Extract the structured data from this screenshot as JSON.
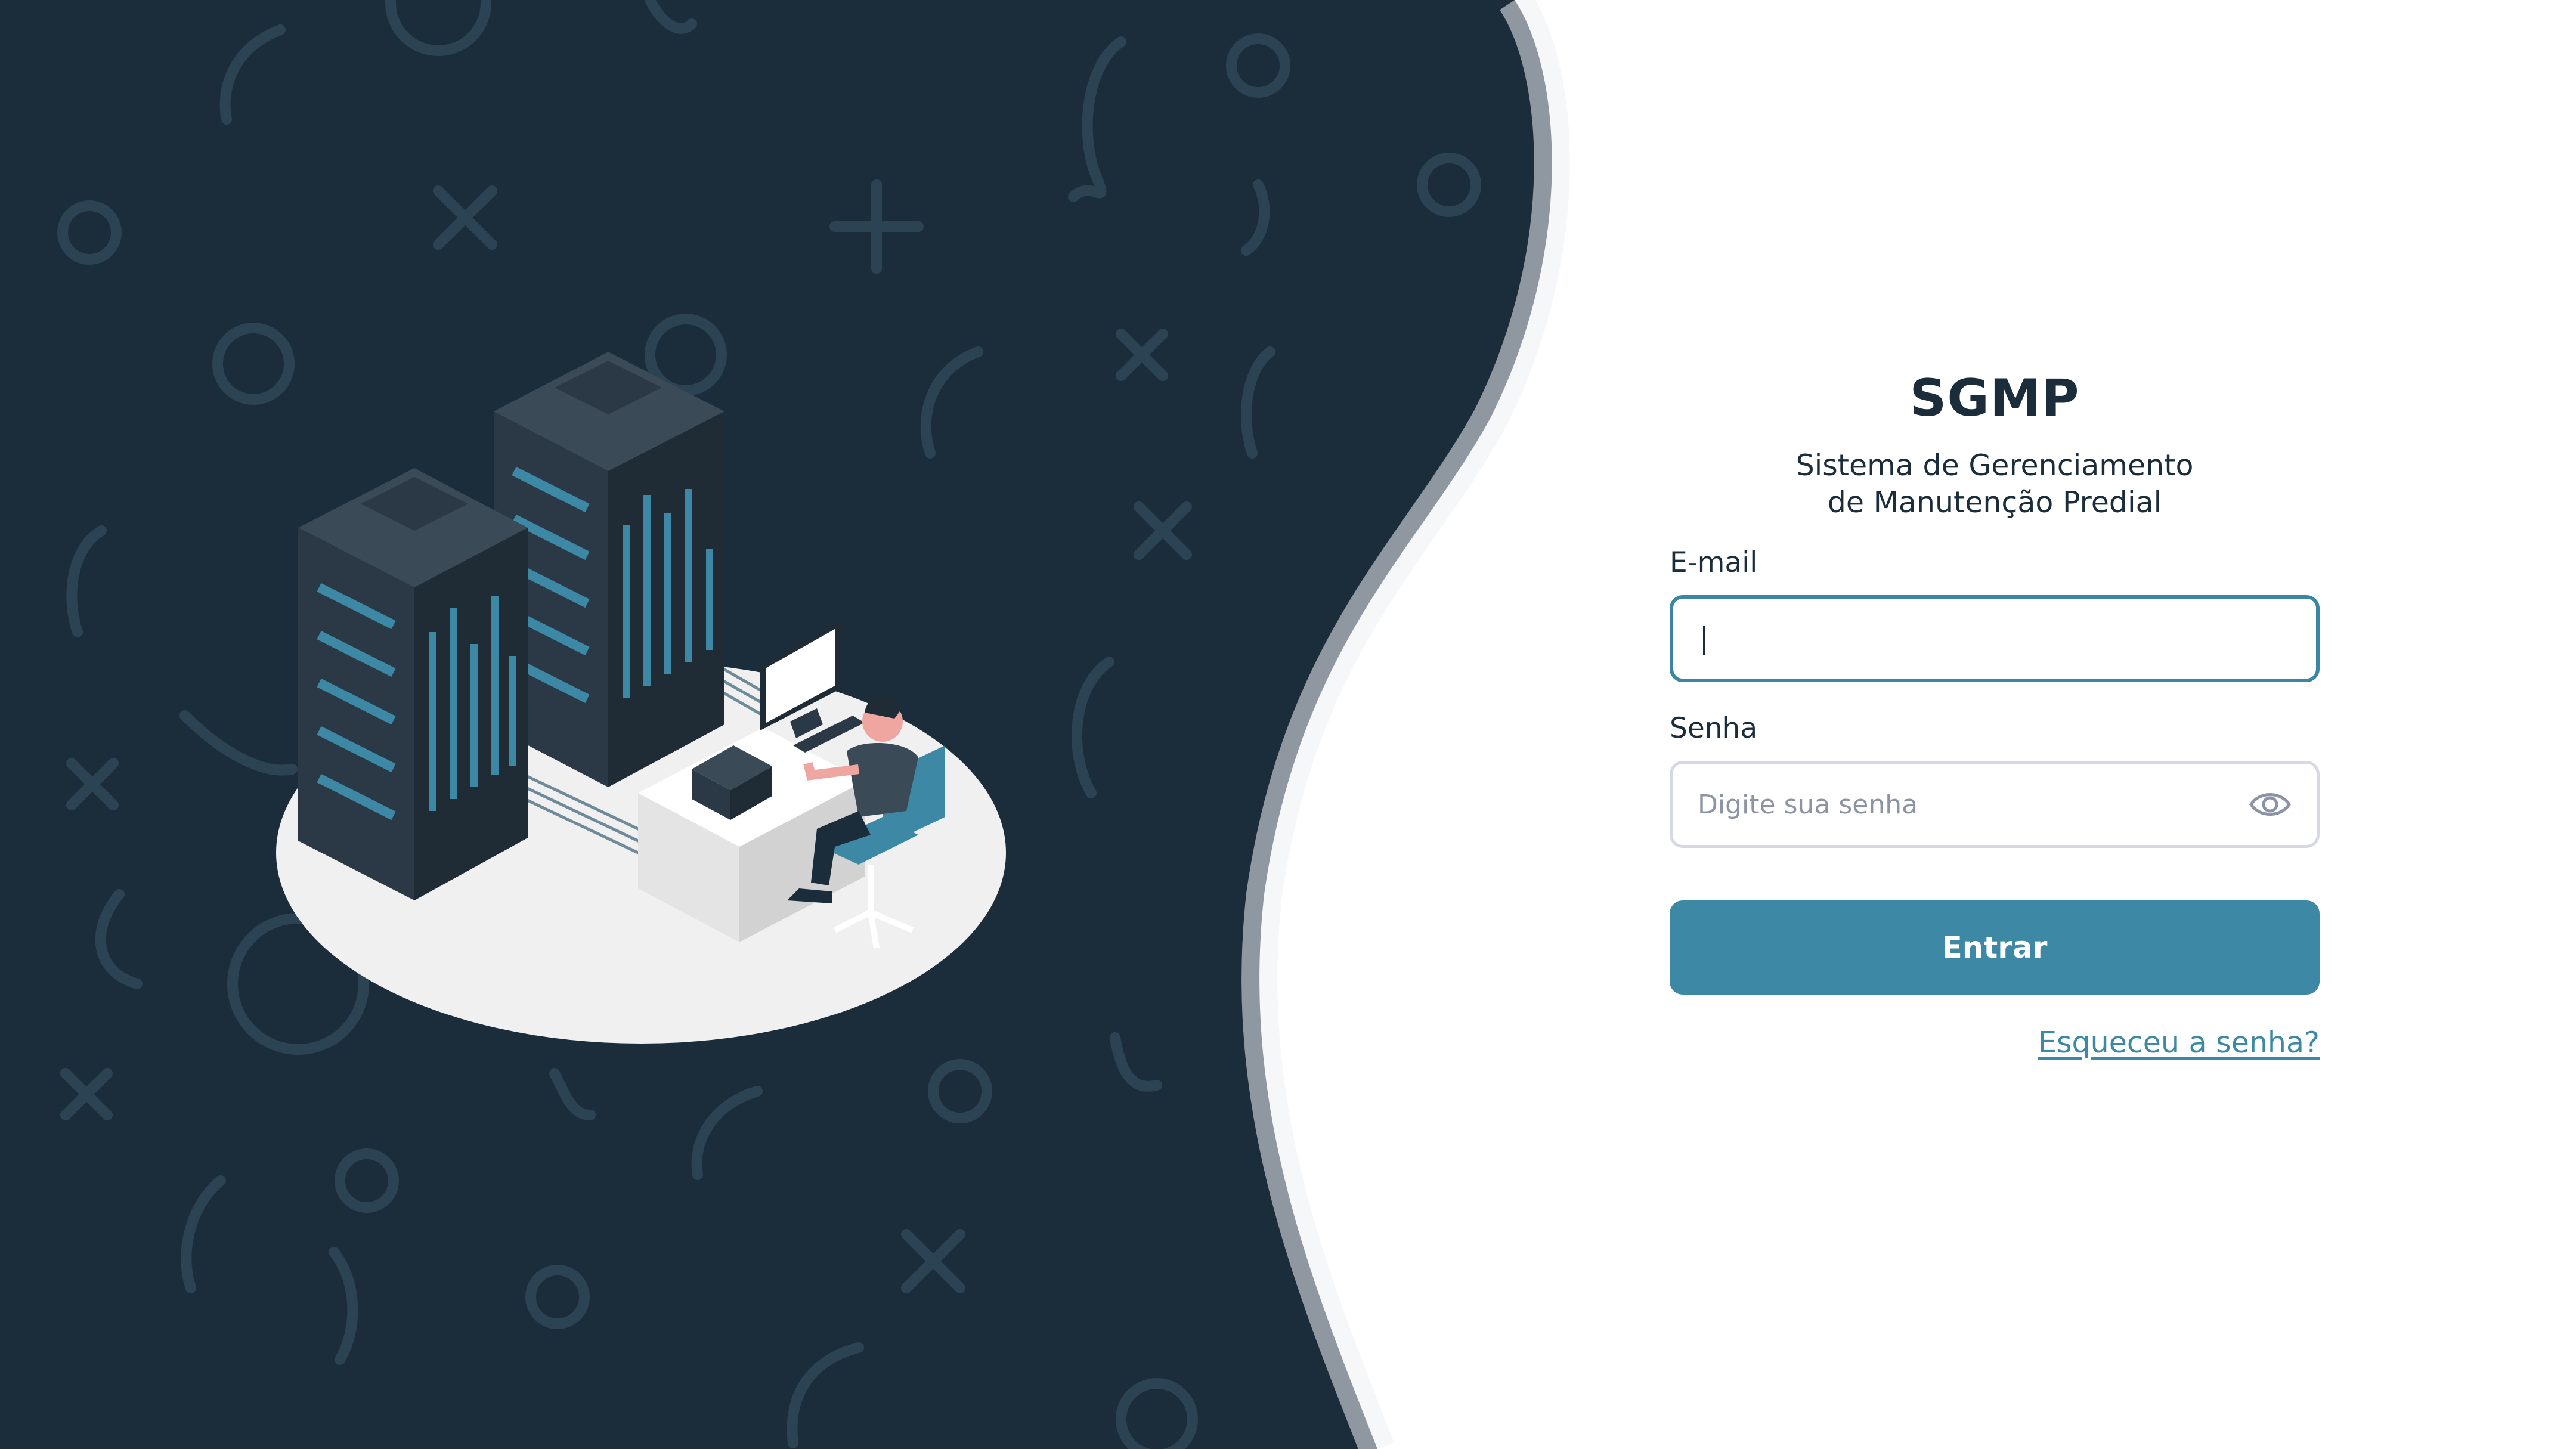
{
  "app": {
    "title": "SGMP",
    "subtitle_line1": "Sistema de Gerenciamento",
    "subtitle_line2": "de Manutenção Predial"
  },
  "form": {
    "email": {
      "label": "E-mail",
      "value": "",
      "state": "focused"
    },
    "password": {
      "label": "Senha",
      "placeholder": "Digite sua senha",
      "value": "",
      "toggle_icon": "eye-icon"
    },
    "submit_label": "Entrar",
    "forgot_label": "Esqueceu a senha?"
  },
  "colors": {
    "navy_background": "#1b2d3b",
    "accent": "#3c88a5",
    "text_dark": "#1b2d3b",
    "input_border": "#d6d8e6",
    "placeholder": "#8b93a4"
  },
  "illustration": "isometric server racks with a person working at a desk"
}
